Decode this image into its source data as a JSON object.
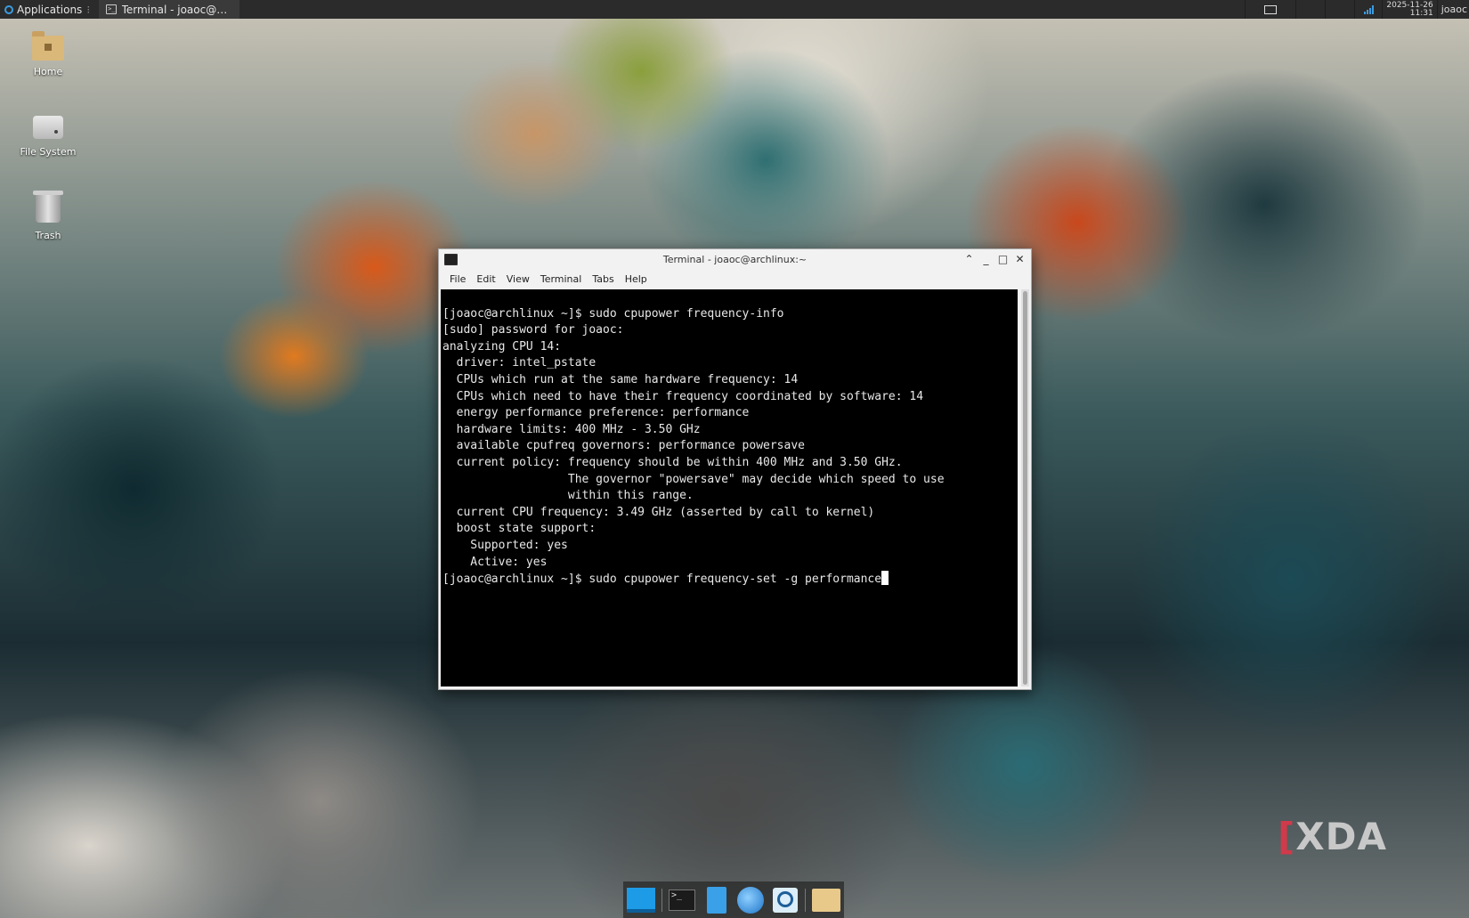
{
  "top_panel": {
    "applications_label": "Applications",
    "task_label": "Terminal - joaoc@archlinu...",
    "clock_date": "2025-11-26",
    "clock_time": "11:31",
    "user_label": "joaoc",
    "accent_color": "#3a9be0"
  },
  "desktop_icons": [
    {
      "label": "Home",
      "icon": "home-folder-icon"
    },
    {
      "label": "File System",
      "icon": "drive-icon"
    },
    {
      "label": "Trash",
      "icon": "trash-icon"
    }
  ],
  "terminal": {
    "title": "Terminal - joaoc@archlinux:~",
    "menu": [
      "File",
      "Edit",
      "View",
      "Terminal",
      "Tabs",
      "Help"
    ],
    "lines": [
      "[joaoc@archlinux ~]$ sudo cpupower frequency-info",
      "[sudo] password for joaoc:",
      "analyzing CPU 14:",
      "  driver: intel_pstate",
      "  CPUs which run at the same hardware frequency: 14",
      "  CPUs which need to have their frequency coordinated by software: 14",
      "  energy performance preference: performance",
      "  hardware limits: 400 MHz - 3.50 GHz",
      "  available cpufreq governors: performance powersave",
      "  current policy: frequency should be within 400 MHz and 3.50 GHz.",
      "                  The governor \"powersave\" may decide which speed to use",
      "                  within this range.",
      "  current CPU frequency: 3.49 GHz (asserted by call to kernel)",
      "  boost state support:",
      "    Supported: yes",
      "    Active: yes"
    ],
    "current_prompt": "[joaoc@archlinux ~]$ sudo cpupower frequency-set -g performance"
  },
  "dock": {
    "items": [
      "show-desktop-icon",
      "terminal-icon",
      "file-manager-icon",
      "web-browser-icon",
      "app-finder-icon",
      "folder-icon"
    ]
  },
  "watermark": {
    "bracket": "[",
    "text": "XDA"
  }
}
